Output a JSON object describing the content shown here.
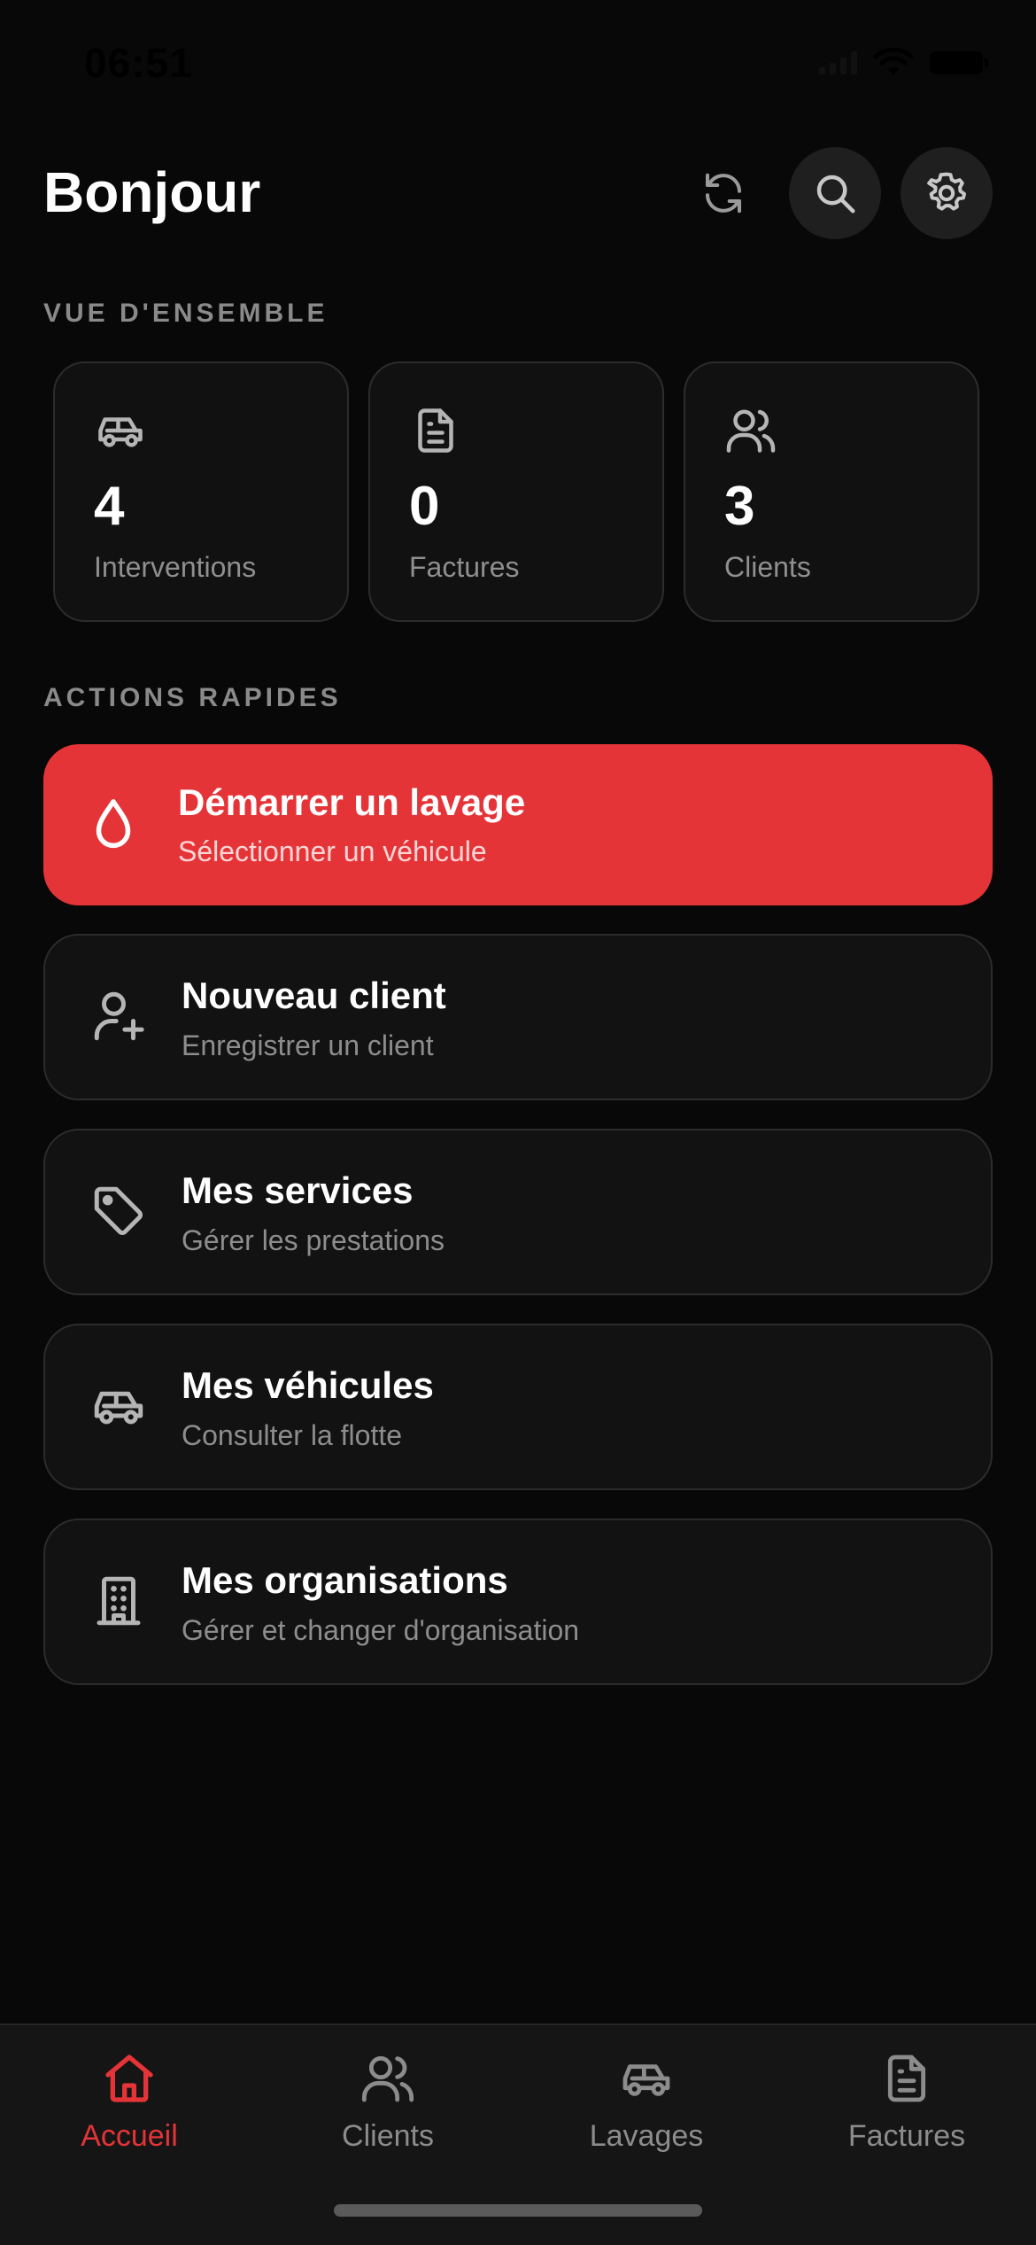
{
  "status_bar": {
    "time": "06:51"
  },
  "header": {
    "title": "Bonjour"
  },
  "overview": {
    "section_label": "VUE D'ENSEMBLE",
    "stats": [
      {
        "icon": "car-icon",
        "value": "4",
        "label": "Interventions"
      },
      {
        "icon": "document-icon",
        "value": "0",
        "label": "Factures"
      },
      {
        "icon": "users-icon",
        "value": "3",
        "label": "Clients"
      }
    ]
  },
  "quick_actions": {
    "section_label": "ACTIONS RAPIDES",
    "items": [
      {
        "icon": "droplet-icon",
        "title": "Démarrer un lavage",
        "subtitle": "Sélectionner un véhicule",
        "primary": true
      },
      {
        "icon": "user-plus-icon",
        "title": "Nouveau client",
        "subtitle": "Enregistrer un client"
      },
      {
        "icon": "tag-icon",
        "title": "Mes services",
        "subtitle": "Gérer les prestations"
      },
      {
        "icon": "car-icon",
        "title": "Mes véhicules",
        "subtitle": "Consulter la flotte"
      },
      {
        "icon": "building-icon",
        "title": "Mes organisations",
        "subtitle": "Gérer et changer d'organisation"
      }
    ]
  },
  "tabbar": {
    "tabs": [
      {
        "icon": "home-icon",
        "label": "Accueil",
        "active": true
      },
      {
        "icon": "users-icon",
        "label": "Clients"
      },
      {
        "icon": "car-icon",
        "label": "Lavages"
      },
      {
        "icon": "document-icon",
        "label": "Factures"
      }
    ]
  },
  "colors": {
    "accent": "#e53437",
    "background": "#080808",
    "card": "#121212"
  }
}
